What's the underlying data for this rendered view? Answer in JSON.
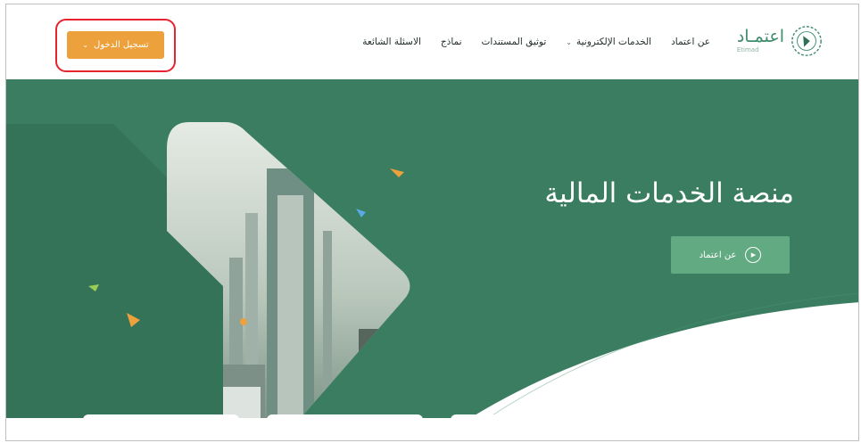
{
  "header": {
    "login_label": "تسجيل الدخول",
    "nav": [
      {
        "label": "عن اعتماد",
        "dropdown": false
      },
      {
        "label": "الخدمات الإلكترونية",
        "dropdown": true
      },
      {
        "label": "توثيق المستندات",
        "dropdown": false
      },
      {
        "label": "نماذج",
        "dropdown": false
      },
      {
        "label": "الاسئلة الشائعة",
        "dropdown": false
      }
    ],
    "logo": {
      "arabic": "اعتمـاد",
      "english": "Etimad"
    }
  },
  "hero": {
    "title": "منصة الخدمات المالية",
    "cta_label": "عن اعتماد"
  },
  "colors": {
    "accent_orange": "#eca13c",
    "hero_green": "#3a7d60",
    "button_green": "#62ab82",
    "highlight_red": "#e8222f"
  },
  "icons": [
    "chevron-down-icon",
    "play-icon",
    "etimad-logo-icon"
  ]
}
